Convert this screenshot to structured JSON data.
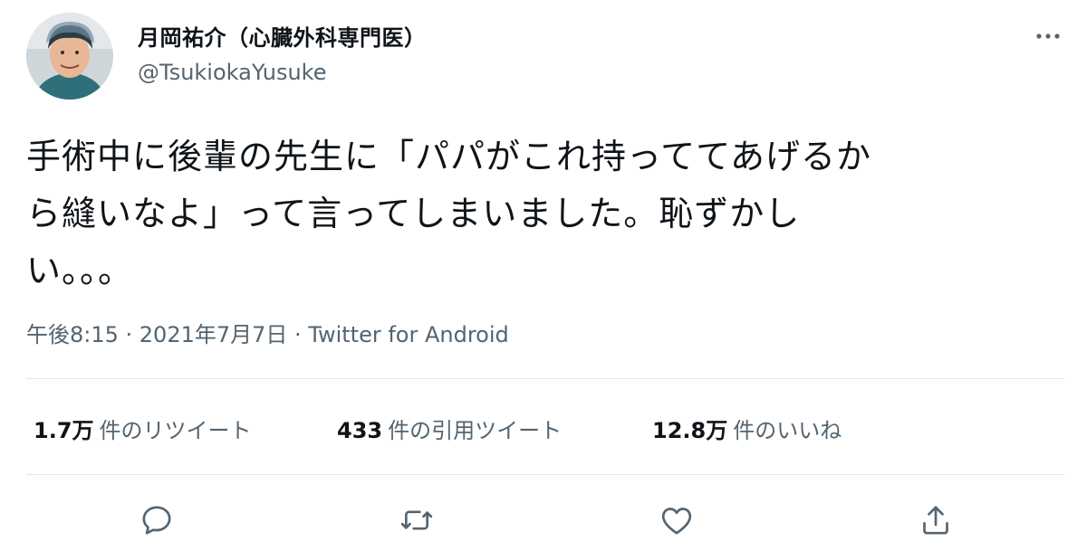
{
  "author": {
    "display_name": "月岡祐介（心臓外科専門医）",
    "handle": "@TsukiokaYusuke"
  },
  "tweet": {
    "text_line1": "手術中に後輩の先生に「パパがこれ持っててあげるか",
    "text_line2": "ら縫いなよ」って言ってしまいました。恥ずかし",
    "text_line3": "い。。。",
    "timestamp": "午後8:15 · 2021年7月7日 · Twitter for Android"
  },
  "stats": {
    "retweets": {
      "count": "1.7万",
      "label": "件のリツイート"
    },
    "quotes": {
      "count": "433",
      "label": "件の引用ツイート"
    },
    "likes": {
      "count": "12.8万",
      "label": "件のいいね"
    }
  },
  "actions": [
    "reply-icon",
    "retweet-icon",
    "like-icon",
    "share-icon"
  ],
  "colors": {
    "text": "#0f1419",
    "secondary": "#536471",
    "divider": "#e1e8ed"
  }
}
